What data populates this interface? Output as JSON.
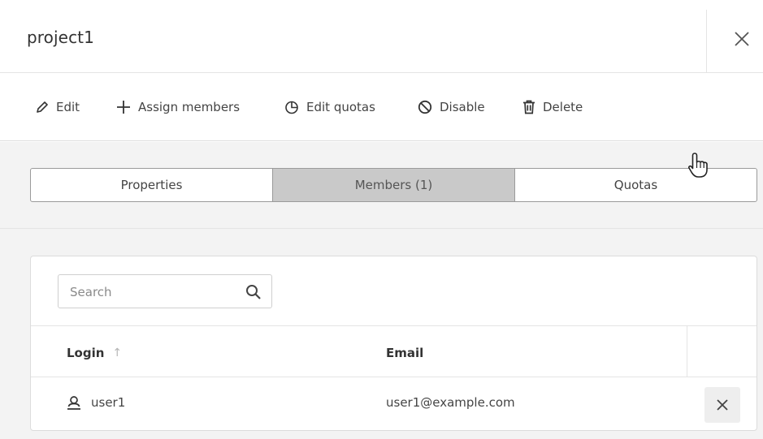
{
  "header": {
    "title": "project1"
  },
  "toolbar": {
    "edit_label": "Edit",
    "assign_label": "Assign members",
    "quotas_label": "Edit quotas",
    "disable_label": "Disable",
    "delete_label": "Delete"
  },
  "tabs": [
    {
      "label": "Properties",
      "active": false
    },
    {
      "label": "Members (1)",
      "active": true
    },
    {
      "label": "Quotas",
      "active": false
    }
  ],
  "search": {
    "placeholder": "Search"
  },
  "table": {
    "columns": [
      "Login",
      "Email"
    ],
    "sort": {
      "column": "Login",
      "direction": "ascending",
      "glyph": "↑"
    },
    "rows": [
      {
        "login": "user1",
        "email": "user1@example.com"
      }
    ]
  },
  "colors": {
    "active_tab": "#c9c9c9",
    "background": "#f3f3f3",
    "border": "#9a9a9a"
  },
  "icons": [
    "close-icon",
    "pencil-icon",
    "plus-icon",
    "pie-chart-icon",
    "ban-icon",
    "trash-icon",
    "search-icon",
    "user-icon",
    "remove-icon",
    "hand-cursor-icon"
  ]
}
